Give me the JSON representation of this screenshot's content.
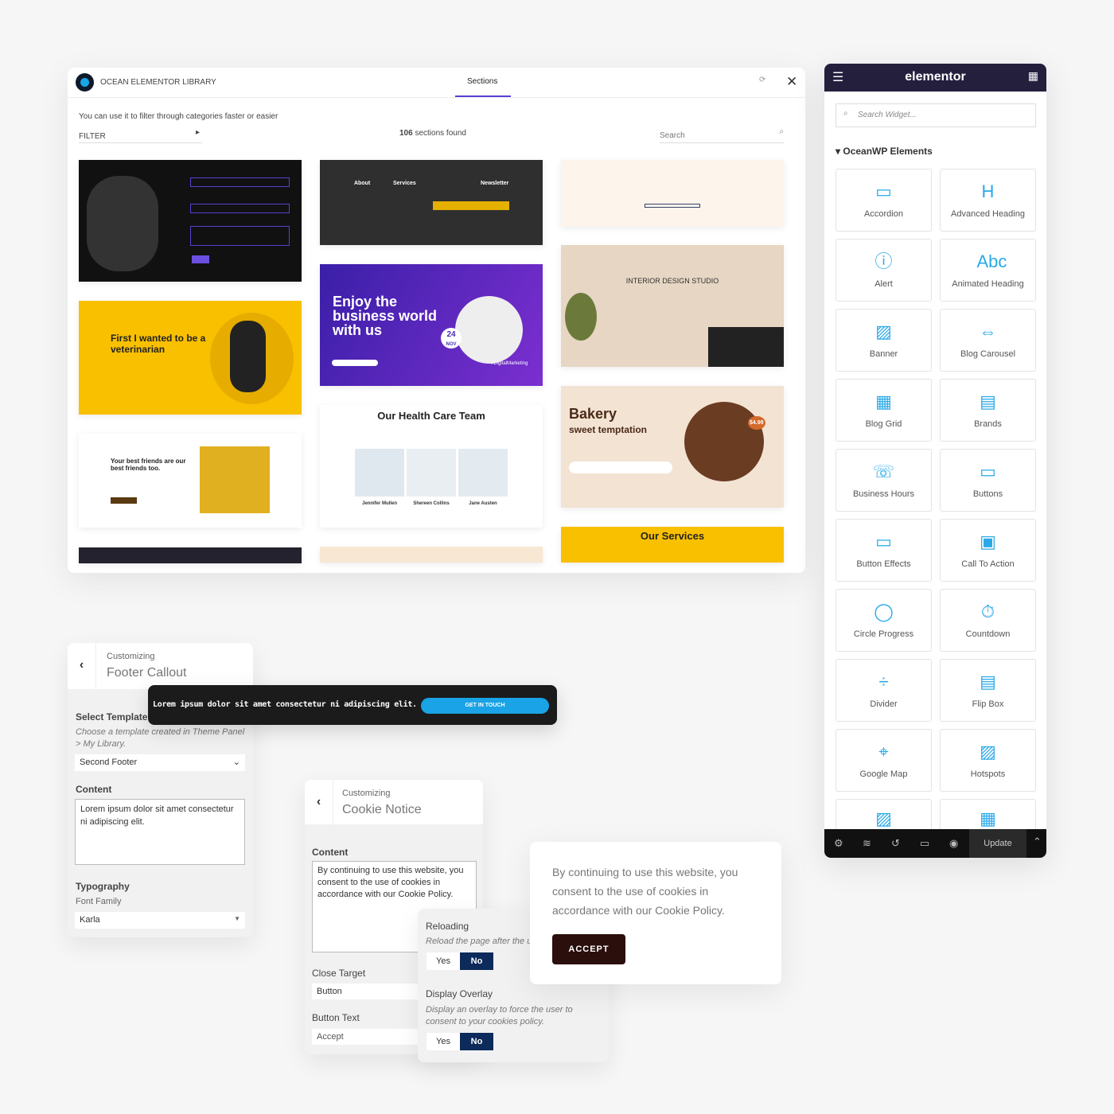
{
  "library": {
    "title": "OCEAN ELEMENTOR LIBRARY",
    "tab": "Sections",
    "hint": "You can use it to filter through categories faster or easier",
    "filter": "FILTER",
    "count_num": "106",
    "count_text": "sections found",
    "search_placeholder": "Search",
    "thumbs": {
      "vet": "First I wanted to be a veterinarian",
      "business": "Enjoy the business world with us",
      "date": "24",
      "month": "NOV",
      "tag": "#DigitalMarketing",
      "about": "About",
      "services": "Services",
      "newsletter": "Newsletter",
      "interior": "INTERIOR DESIGN STUDIO",
      "health": "Our Health Care Team",
      "doctors": [
        "Jennifer Mullen",
        "Shereen Collins",
        "Jane Austen"
      ],
      "bakery": "Bakery",
      "bakery_sub": "sweet temptation",
      "price": "$4.99",
      "friends": "Your best friends are our best friends too.",
      "our_services": "Our Services"
    }
  },
  "elementor": {
    "brand": "elementor",
    "search_placeholder": "Search Widget...",
    "category": "OceanWP Elements",
    "update": "Update",
    "widgets": [
      {
        "label": "Accordion",
        "icon": "▭"
      },
      {
        "label": "Advanced Heading",
        "icon": "H"
      },
      {
        "label": "Alert",
        "icon": "ⓘ"
      },
      {
        "label": "Animated Heading",
        "icon": "Abc"
      },
      {
        "label": "Banner",
        "icon": "▨"
      },
      {
        "label": "Blog Carousel",
        "icon": "⇔"
      },
      {
        "label": "Blog Grid",
        "icon": "▦"
      },
      {
        "label": "Brands",
        "icon": "▤"
      },
      {
        "label": "Business Hours",
        "icon": "☏"
      },
      {
        "label": "Buttons",
        "icon": "▭"
      },
      {
        "label": "Button Effects",
        "icon": "▭"
      },
      {
        "label": "Call To Action",
        "icon": "▣"
      },
      {
        "label": "Circle Progress",
        "icon": "◯"
      },
      {
        "label": "Countdown",
        "icon": "⏱"
      },
      {
        "label": "Divider",
        "icon": "÷"
      },
      {
        "label": "Flip Box",
        "icon": "▤"
      },
      {
        "label": "Google Map",
        "icon": "⌖"
      },
      {
        "label": "Hotspots",
        "icon": "▨"
      }
    ]
  },
  "footer_callout": {
    "customizing": "Customizing",
    "title": "Footer Callout",
    "select_label": "Select Template",
    "select_hint": "Choose a template created in Theme Panel > My Library.",
    "select_value": "Second Footer",
    "content_label": "Content",
    "content_value": "Lorem ipsum dolor sit amet consectetur ni adipiscing elit.",
    "typography": "Typography",
    "font_family_label": "Font Family",
    "font_family": "Karla"
  },
  "callout_bar": {
    "text": "Lorem ipsum dolor sit amet consectetur ni adipiscing elit.",
    "button": "GET IN TOUCH"
  },
  "cookie_notice": {
    "customizing": "Customizing",
    "title": "Cookie Notice",
    "content_label": "Content",
    "content_value": "By continuing to use this website, you consent to the use of cookies in accordance with our Cookie Policy.",
    "close_target_label": "Close Target",
    "close_target": "Button",
    "button_text_label": "Button Text",
    "button_text": "Accept"
  },
  "options": {
    "reloading": "Reloading",
    "reloading_hint": "Reload the page after the us",
    "display_overlay": "Display Overlay",
    "overlay_hint": "Display an overlay to force the user to consent to your cookies policy.",
    "yes": "Yes",
    "no": "No"
  },
  "cookie_popup": {
    "text": "By continuing to use this website, you consent to the use of cookies in accordance with our Cookie Policy.",
    "button": "ACCEPT"
  }
}
